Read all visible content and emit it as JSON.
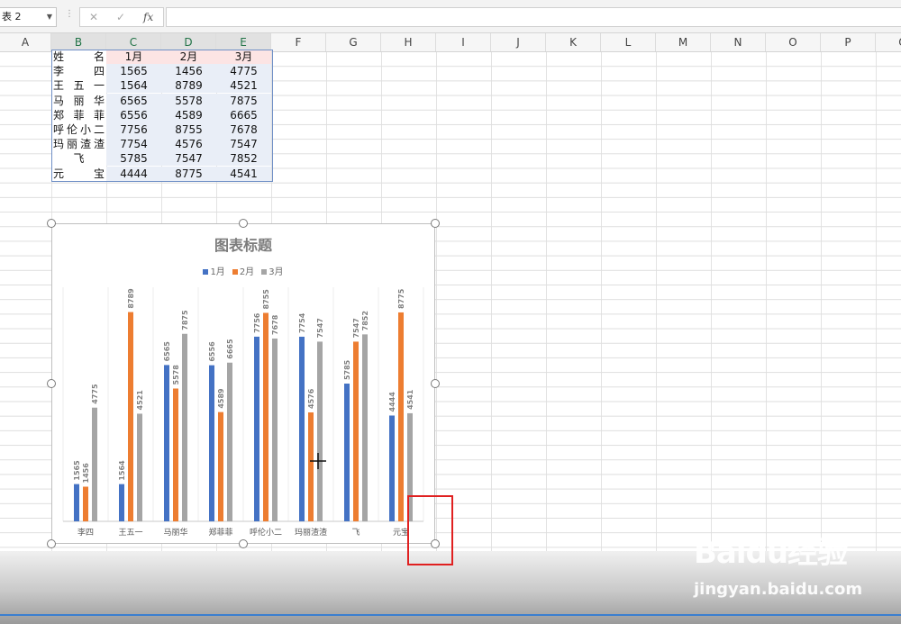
{
  "formula_bar": {
    "name_box": "表 2",
    "cancel": "✕",
    "enter": "✓",
    "fx": "fx",
    "value": ""
  },
  "columns": [
    "A",
    "B",
    "C",
    "D",
    "E",
    "F",
    "G",
    "H",
    "I",
    "J",
    "K",
    "L",
    "M",
    "N",
    "O",
    "P",
    "Q"
  ],
  "selected_columns": [
    "B",
    "C",
    "D",
    "E"
  ],
  "table": {
    "header": {
      "name": "姓名",
      "m1": "1月",
      "m2": "2月",
      "m3": "3月"
    },
    "rows": [
      {
        "name": "李四",
        "m1": "1565",
        "m2": "1456",
        "m3": "4775"
      },
      {
        "name": "王五一",
        "m1": "1564",
        "m2": "8789",
        "m3": "4521"
      },
      {
        "name": "马丽华",
        "m1": "6565",
        "m2": "5578",
        "m3": "7875"
      },
      {
        "name": "郑菲菲",
        "m1": "6556",
        "m2": "4589",
        "m3": "6665"
      },
      {
        "name": "呼伦小二",
        "m1": "7756",
        "m2": "8755",
        "m3": "7678"
      },
      {
        "name": "玛丽渣渣",
        "m1": "7754",
        "m2": "4576",
        "m3": "7547"
      },
      {
        "name": "飞",
        "m1": "5785",
        "m2": "7547",
        "m3": "7852"
      },
      {
        "name": "元宝",
        "m1": "4444",
        "m2": "8775",
        "m3": "4541"
      }
    ]
  },
  "chart_data": {
    "type": "bar",
    "title": "图表标题",
    "categories": [
      "李四",
      "王五一",
      "马丽华",
      "郑菲菲",
      "呼伦小二",
      "玛丽渣渣",
      "飞",
      "元宝"
    ],
    "series": [
      {
        "name": "1月",
        "color": "#4472c4",
        "values": [
          1565,
          1564,
          6565,
          6556,
          7756,
          7754,
          5785,
          4444
        ]
      },
      {
        "name": "2月",
        "color": "#ed7d31",
        "values": [
          1456,
          8789,
          5578,
          4589,
          8755,
          4576,
          7547,
          8775
        ]
      },
      {
        "name": "3月",
        "color": "#a5a5a5",
        "values": [
          4775,
          4521,
          7875,
          6665,
          7678,
          7547,
          7852,
          4541
        ]
      }
    ],
    "ylim": [
      0,
      9000
    ],
    "grid": true,
    "legend": "top"
  },
  "watermark": {
    "brand": "Baidu经验",
    "url": "jingyan.baidu.com"
  }
}
